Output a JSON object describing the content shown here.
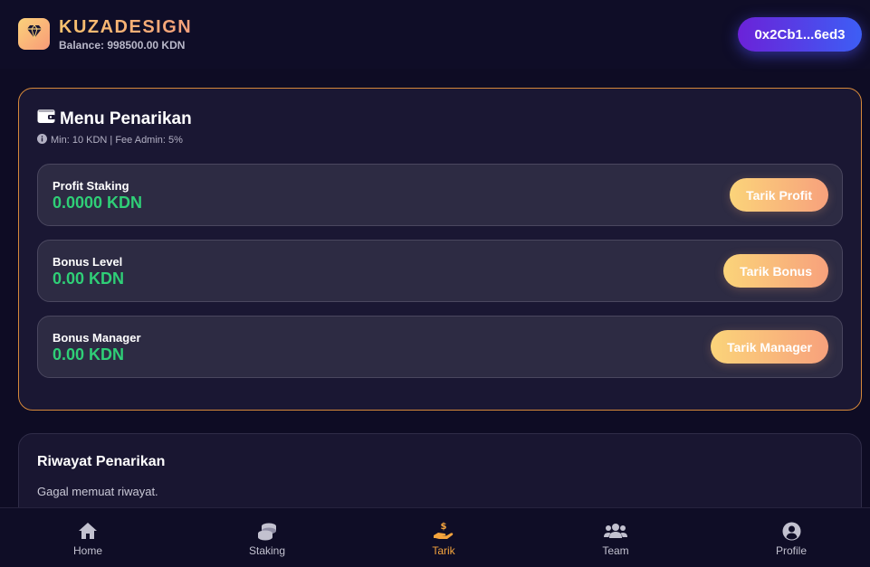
{
  "header": {
    "brand": "KUZADESIGN",
    "balance": "Balance: 998500.00 KDN",
    "wallet": "0x2Cb1...6ed3",
    "logo_icon": "diamond-icon"
  },
  "withdraw_menu": {
    "title": "Menu Penarikan",
    "title_icon": "wallet-icon",
    "info_icon": "info-icon",
    "subtitle": "Min: 10 KDN | Fee Admin: 5%",
    "rows": [
      {
        "label": "Profit Staking",
        "value": "0.0000 KDN",
        "button": "Tarik Profit"
      },
      {
        "label": "Bonus Level",
        "value": "0.00 KDN",
        "button": "Tarik Bonus"
      },
      {
        "label": "Bonus Manager",
        "value": "0.00 KDN",
        "button": "Tarik Manager"
      }
    ]
  },
  "history": {
    "title": "Riwayat Penarikan",
    "message": "Gagal memuat riwayat."
  },
  "nav": {
    "items": [
      {
        "label": "Home",
        "icon": "home-icon"
      },
      {
        "label": "Staking",
        "icon": "coins-icon"
      },
      {
        "label": "Tarik",
        "icon": "hand-dollar-icon",
        "active": true
      },
      {
        "label": "Team",
        "icon": "users-icon"
      },
      {
        "label": "Profile",
        "icon": "user-circle-icon"
      }
    ]
  },
  "colors": {
    "background": "#0e0c24",
    "accent_orange": "#f5a43d",
    "value_green": "#2fcf77",
    "wallet_gradient_start": "#6b22d8",
    "wallet_gradient_end": "#3d5ef5"
  }
}
